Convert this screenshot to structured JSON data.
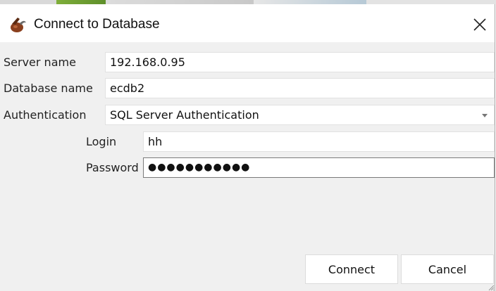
{
  "window": {
    "title": "Connect to Database",
    "close_glyph": "✕"
  },
  "form": {
    "server_name": {
      "label": "Server name",
      "value": "192.168.0.95"
    },
    "database_name": {
      "label": "Database name",
      "value": "ecdb2"
    },
    "authentication": {
      "label": "Authentication",
      "value": "SQL Server Authentication"
    },
    "login": {
      "label": "Login",
      "value": "hh"
    },
    "password": {
      "label": "Password",
      "value": "●●●●●●●●●●●"
    }
  },
  "buttons": {
    "connect_label": "Connect",
    "cancel_label": "Cancel"
  },
  "icons": {
    "app": "app-logo-icon",
    "close": "close-icon",
    "dropdown": "chevron-down-icon",
    "resize": "resize-grip-icon"
  },
  "colors": {
    "dialog_background": "#f0f0f0",
    "field_background": "#ffffff",
    "title_background": "#ffffff"
  }
}
